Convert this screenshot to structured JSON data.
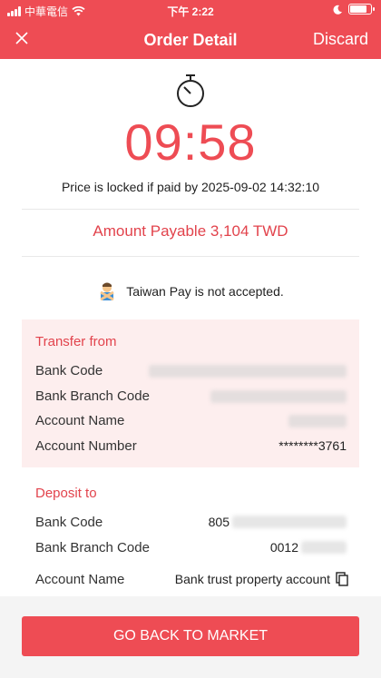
{
  "status_bar": {
    "carrier": "中華電信",
    "time": "下午 2:22",
    "battery_level": 0.85
  },
  "nav": {
    "close_icon": "close-icon",
    "title": "Order Detail",
    "discard_label": "Discard"
  },
  "timer": {
    "icon": "stopwatch-icon",
    "countdown": "09:58",
    "locked_note": "Price is locked if paid by 2025-09-02 14:32:10"
  },
  "amount_payable": "Amount Payable 3,104 TWD",
  "notice": {
    "icon": "person-crossed-arms-emoji",
    "text": "Taiwan Pay is not accepted."
  },
  "transfer_from": {
    "title": "Transfer from",
    "rows": [
      {
        "label": "Bank Code",
        "value": ""
      },
      {
        "label": "Bank Branch Code",
        "value": ""
      },
      {
        "label": "Account Name",
        "value": ""
      },
      {
        "label": "Account Number",
        "value": "********3761"
      }
    ]
  },
  "deposit_to": {
    "title": "Deposit to",
    "rows": [
      {
        "label": "Bank Code",
        "value": "805"
      },
      {
        "label": "Bank Branch Code",
        "value": "0012"
      },
      {
        "label": "Account Name",
        "value": "Bank trust property account"
      }
    ],
    "copy_icon": "copy-icon"
  },
  "footer": {
    "button_label": "GO BACK TO MARKET"
  },
  "colors": {
    "accent": "#ee4c54",
    "panel_background": "#fdeeee"
  }
}
